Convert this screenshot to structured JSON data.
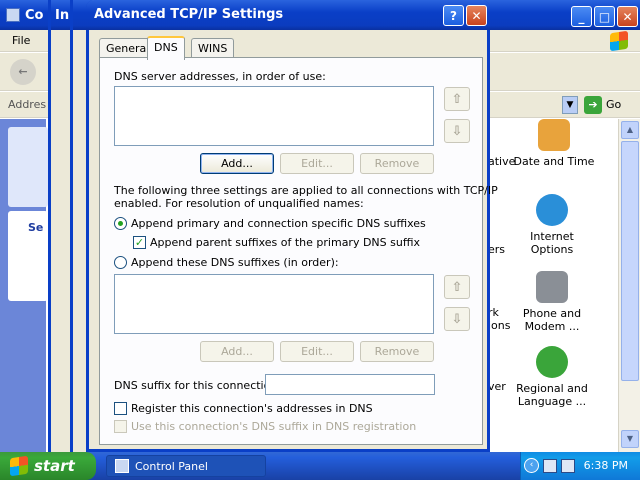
{
  "background_window": {
    "title": "Co",
    "menu_file": "File",
    "address_label": "Addres",
    "go_label": "Go",
    "left_panel_heading": "Se",
    "stack_titles": [
      "In",
      ""
    ],
    "clipped_labels": [
      "ative",
      "ers",
      "rk",
      "ions",
      "ver"
    ],
    "items": [
      {
        "label": "Date and Time",
        "icon": "clock-icon",
        "color": "#e8a33c"
      },
      {
        "label": "Internet Options",
        "icon": "globe-icon",
        "color": "#2a8fd8"
      },
      {
        "label": "Phone and Modem ...",
        "icon": "phone-icon",
        "color": "#8a8f96"
      },
      {
        "label": "Regional and Language ...",
        "icon": "globe-icon",
        "color": "#3aa53a"
      }
    ]
  },
  "dialog": {
    "title": "Advanced TCP/IP Settings",
    "help_label": "?",
    "close_label": "✕",
    "tabs": [
      {
        "label": "General",
        "active": false
      },
      {
        "label": "DNS",
        "active": true
      },
      {
        "label": "WINS",
        "active": false
      }
    ],
    "dns_servers_label": "DNS server addresses, in order of use:",
    "buttons1": {
      "add": "Add...",
      "edit": "Edit...",
      "remove": "Remove"
    },
    "info_text_line1": "The following three settings are applied to all connections with TCP/IP",
    "info_text_line2": "enabled. For resolution of unqualified names:",
    "radio_primary": "Append primary and connection specific DNS suffixes",
    "check_parent": "Append parent suffixes of the primary DNS suffix",
    "radio_these": "Append these DNS suffixes (in order):",
    "buttons2": {
      "add": "Add...",
      "edit": "Edit...",
      "remove": "Remove"
    },
    "suffix_label": "DNS suffix for this connection:",
    "suffix_value": "",
    "register_label": "Register this connection's addresses in DNS",
    "use_suffix_label": "Use this connection's DNS suffix in DNS registration",
    "arrow_up": "⇧",
    "arrow_down": "⇩"
  },
  "taskbar": {
    "start_label": "start",
    "task_label": "Control Panel",
    "clock": "6:38 PM"
  }
}
